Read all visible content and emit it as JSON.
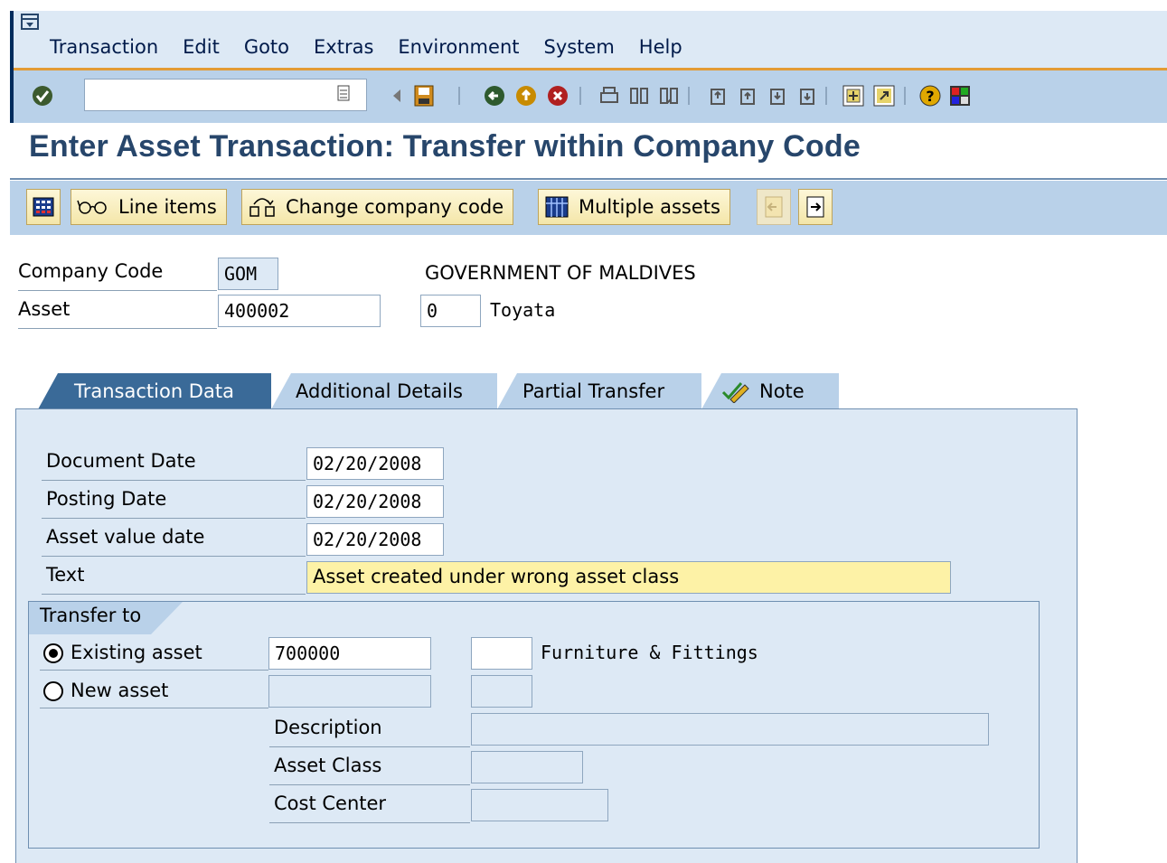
{
  "menu": {
    "items": [
      "Transaction",
      "Edit",
      "Goto",
      "Extras",
      "Environment",
      "System",
      "Help"
    ]
  },
  "toolbar": {
    "command_value": "",
    "icons": [
      "enter-icon",
      "back-arrow-icon",
      "save-icon",
      "back-icon",
      "exit-icon",
      "cancel-icon",
      "print-icon",
      "find-icon",
      "find-next-icon",
      "first-page-icon",
      "previous-page-icon",
      "next-page-icon",
      "last-page-icon",
      "create-session-icon",
      "shortcut-icon",
      "help-icon",
      "layout-icon"
    ]
  },
  "page": {
    "title": "Enter Asset Transaction: Transfer within Company Code"
  },
  "app_toolbar": {
    "line_items": "Line items",
    "change_company_code": "Change company code",
    "multiple_assets": "Multiple assets"
  },
  "header": {
    "company_code_label": "Company Code",
    "company_code_value": "GOM",
    "company_name": "GOVERNMENT OF MALDIVES",
    "asset_label": "Asset",
    "asset_value": "400002",
    "subnumber_value": "0",
    "asset_description": "Toyata"
  },
  "tabs": [
    {
      "label": "Transaction Data",
      "active": true
    },
    {
      "label": "Additional Details",
      "active": false
    },
    {
      "label": "Partial Transfer",
      "active": false
    },
    {
      "label": "Note",
      "active": false
    }
  ],
  "transaction": {
    "document_date_label": "Document Date",
    "document_date": "02/20/2008",
    "posting_date_label": "Posting Date",
    "posting_date": "02/20/2008",
    "asset_value_date_label": "Asset value date",
    "asset_value_date": "02/20/2008",
    "text_label": "Text",
    "text_value": "Asset created under wrong asset class"
  },
  "transfer_to": {
    "title": "Transfer to",
    "existing_asset_label": "Existing asset",
    "existing_asset_value": "700000",
    "existing_subnumber": "",
    "existing_description": "Furniture & Fittings",
    "new_asset_label": "New asset",
    "selected": "existing",
    "description_label": "Description",
    "asset_class_label": "Asset Class",
    "cost_center_label": "Cost Center"
  }
}
